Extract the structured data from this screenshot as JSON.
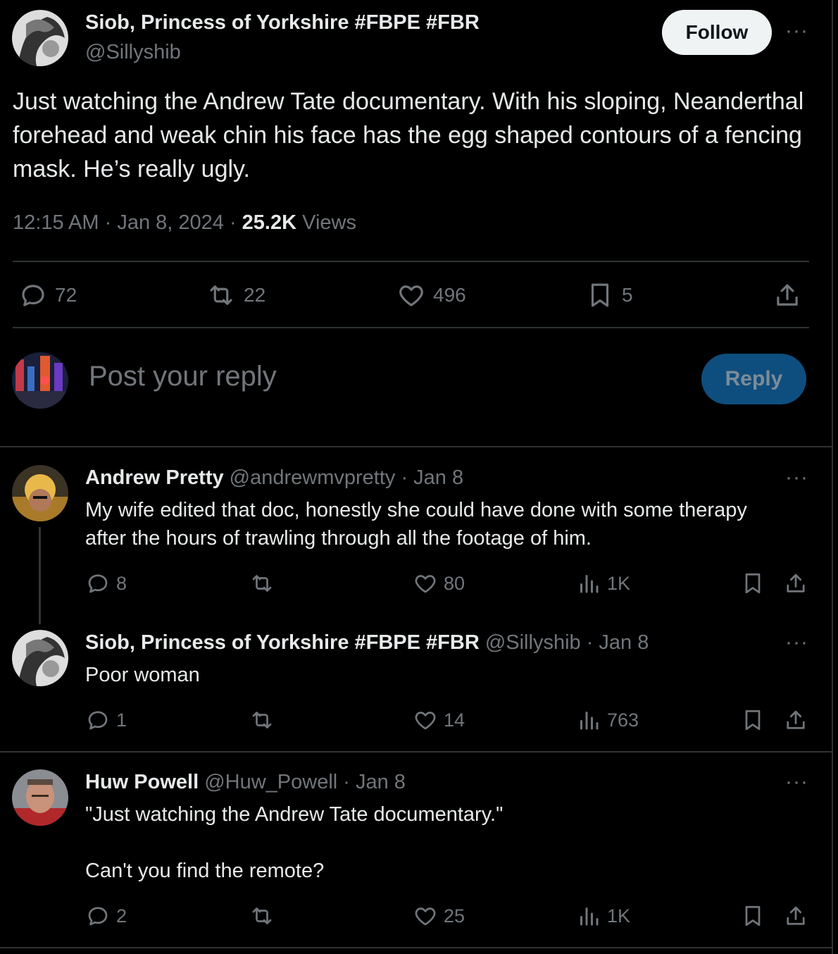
{
  "main_tweet": {
    "author_name": "Siob, Princess of Yorkshire #FBPE #FBR",
    "handle": "@Sillyshib",
    "follow_label": "Follow",
    "text": "Just watching the Andrew Tate documentary. With his sloping, Neanderthal forehead and weak chin his face has the egg shaped contours of a fencing mask. He’s really ugly.",
    "time": "12:15 AM",
    "date": "Jan 8, 2024",
    "views_count": "25.2K",
    "views_label": "Views",
    "stats": {
      "replies": "72",
      "reposts": "22",
      "likes": "496",
      "bookmarks": "5"
    }
  },
  "composer": {
    "placeholder": "Post your reply",
    "reply_label": "Reply"
  },
  "replies": [
    {
      "author_name": "Andrew Pretty",
      "handle_date": "@andrewmvpretty · Jan 8",
      "text_lines": [
        "My wife edited that doc, honestly she could have done with some therapy",
        "after the hours of trawling through all the footage of him."
      ],
      "replies": "8",
      "likes": "80",
      "views": "1K"
    },
    {
      "author_name": "Siob, Princess of Yorkshire #FBPE #FBR",
      "handle_date": "@Sillyshib · Jan 8",
      "text_lines": [
        "Poor woman"
      ],
      "replies": "1",
      "likes": "14",
      "views": "763"
    },
    {
      "author_name": "Huw Powell",
      "handle_date": "@Huw_Powell · Jan 8",
      "text_lines": [
        "\"Just watching the Andrew Tate documentary.\"",
        "Can't you find the remote?"
      ],
      "replies": "2",
      "likes": "25",
      "views": "1K"
    }
  ],
  "colors": {
    "background": "#000000",
    "text": "#e7e9ea",
    "muted": "#71767b",
    "divider": "#2f3336",
    "reply_button": "#0e4e7e"
  },
  "icons": [
    "more-icon",
    "reply-icon",
    "repost-icon",
    "like-icon",
    "bookmark-icon",
    "share-icon",
    "views-icon"
  ]
}
